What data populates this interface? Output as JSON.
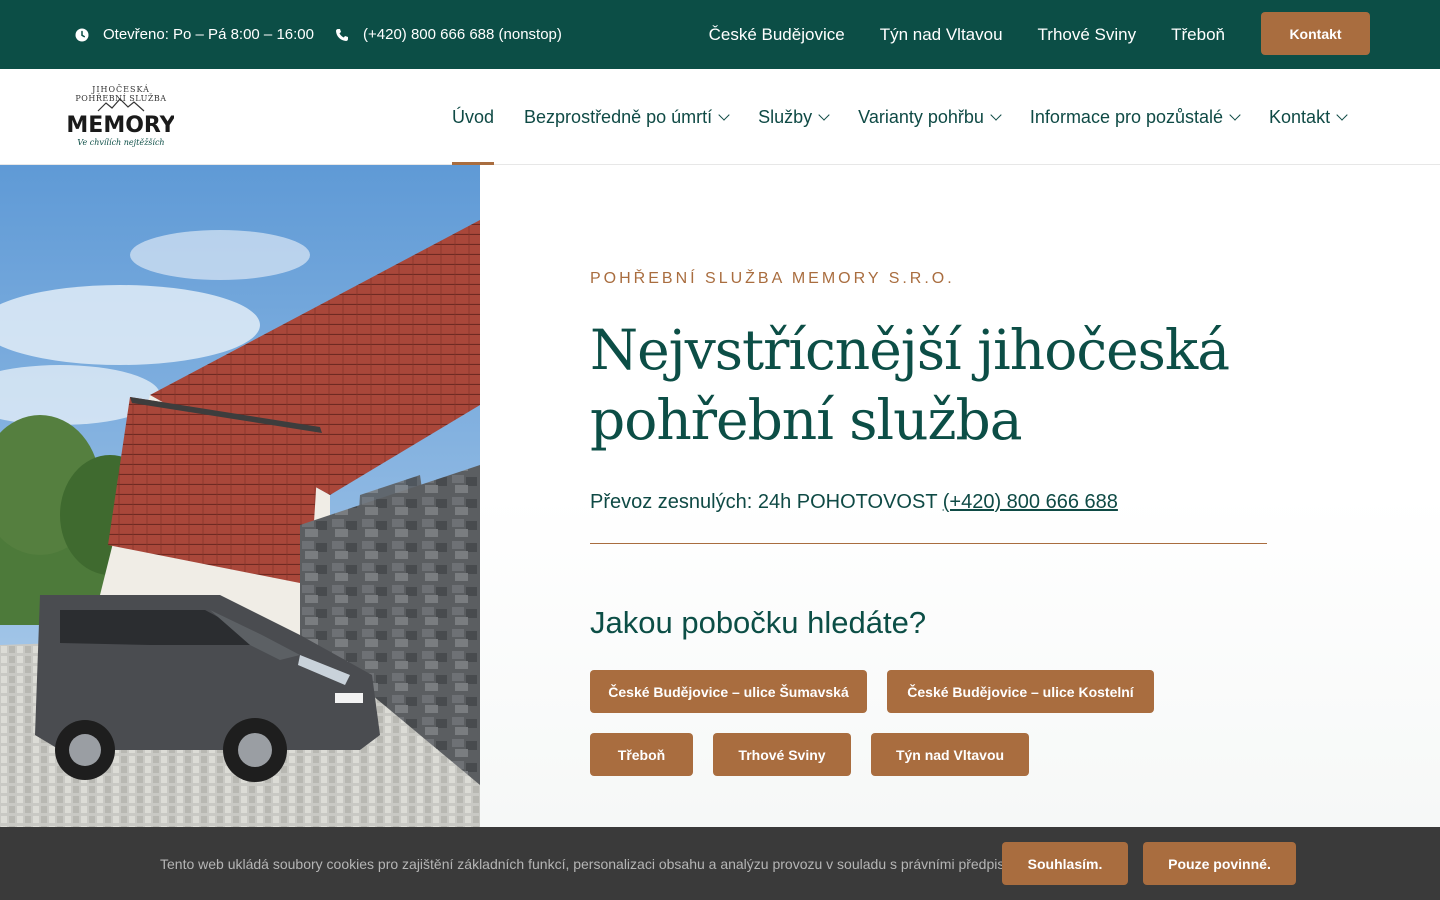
{
  "topbar": {
    "hours": "Otevřeno: Po – Pá 8:00 – 16:00",
    "phone": "(+420) 800 666 688 (nonstop)",
    "links": [
      "České Budějovice",
      "Týn nad Vltavou",
      "Trhové Sviny",
      "Třeboň"
    ],
    "contact_button": "Kontakt"
  },
  "logo": {
    "arc_text": "JIHOČESKÁ POHŘEBNÍ SLUŽBA",
    "brand": "MEMORY",
    "tagline": "Ve chvílích nejtěžších"
  },
  "nav": {
    "items": [
      {
        "label": "Úvod",
        "dropdown": false,
        "active": true
      },
      {
        "label": "Bezprostředně po úmrtí",
        "dropdown": true
      },
      {
        "label": "Služby",
        "dropdown": true
      },
      {
        "label": "Varianty pohřbu",
        "dropdown": true
      },
      {
        "label": "Informace pro pozůstalé",
        "dropdown": true
      },
      {
        "label": "Kontakt",
        "dropdown": true
      }
    ]
  },
  "hero": {
    "kicker": "POHŘEBNÍ SLUŽBA MEMORY S.R.O.",
    "headline_line1": "Nejvstřícnější jihočeská",
    "headline_line2": "pohřební služba",
    "transport_text": "Převoz zesnulých: 24h POHOTOVOST",
    "transport_phone": "(+420) 800 666 688",
    "branch_question": "Jakou pobočku hledáte?",
    "branches": [
      "České Budějovice – ulice Šumavská",
      "České Budějovice – ulice Kostelní",
      "Třeboň",
      "Trhové Sviny",
      "Týn nad Vltavou"
    ]
  },
  "cookie": {
    "text": "Tento web ukládá soubory cookies pro zajištění základních funkcí, personalizaci obsahu a analýzu provozu v souladu s právními předpisy.",
    "accept": "Souhlasím.",
    "required_only": "Pouze povinné."
  },
  "colors": {
    "primary_green": "#0c4e46",
    "accent_brown": "#a96d3f",
    "cookie_bg": "#3a3a3a"
  }
}
